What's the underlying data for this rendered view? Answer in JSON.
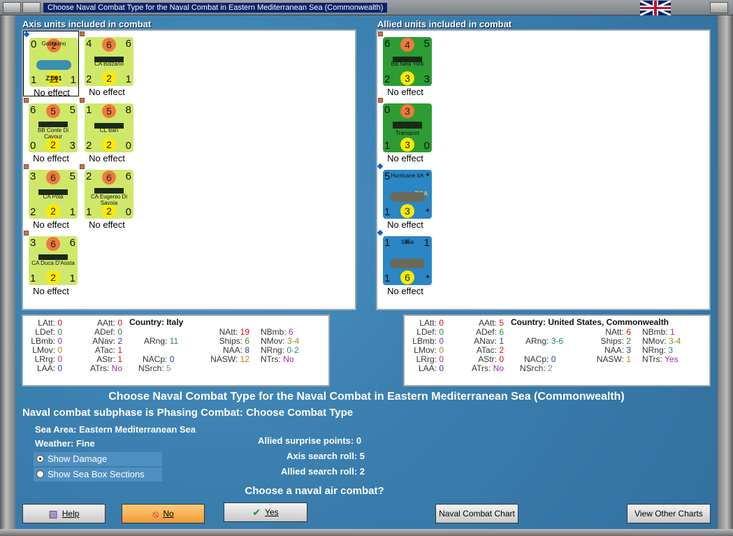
{
  "window": {
    "title": "Choose Naval Combat Type for the Naval Combat in Eastern Mediterranean Sea (Commonwealth)"
  },
  "axis": {
    "title": "Axis units included in combat",
    "units": [
      {
        "name": "Gabbiano",
        "sub": "Z.501",
        "tl": "0",
        "tm": "2",
        "tr": "",
        "bl": "1",
        "bm": "11",
        "br": "1",
        "effect": "No effect",
        "color": "yellow",
        "kind": "plane"
      },
      {
        "name": "CA Bolzano",
        "sub": "",
        "tl": "4",
        "tm": "6",
        "tr": "6",
        "bl": "2",
        "bm": "2",
        "br": "1",
        "effect": "No effect",
        "color": "yellow",
        "kind": "ship"
      },
      {
        "name": "BB Conte Di Cavour",
        "sub": "",
        "tl": "6",
        "tm": "5",
        "tr": "5",
        "bl": "0",
        "bm": "2",
        "br": "3",
        "effect": "No effect",
        "color": "yellow",
        "kind": "ship"
      },
      {
        "name": "CL Bari",
        "sub": "",
        "tl": "1",
        "tm": "5",
        "tr": "8",
        "bl": "2",
        "bm": "2",
        "br": "0",
        "effect": "No effect",
        "color": "yellow",
        "kind": "ship"
      },
      {
        "name": "CA Pola",
        "sub": "",
        "tl": "3",
        "tm": "6",
        "tr": "5",
        "bl": "2",
        "bm": "2",
        "br": "1",
        "effect": "No effect",
        "color": "yellow",
        "kind": "ship"
      },
      {
        "name": "CA Eugenio Di Savoia",
        "sub": "",
        "tl": "2",
        "tm": "6",
        "tr": "6",
        "bl": "1",
        "bm": "2",
        "br": "0",
        "effect": "No effect",
        "color": "yellow",
        "kind": "ship"
      },
      {
        "name": "CA Duca D'Aosta",
        "sub": "",
        "tl": "3",
        "tm": "6",
        "tr": "6",
        "bl": "1",
        "bm": "2",
        "br": "1",
        "effect": "No effect",
        "color": "yellow",
        "kind": "ship"
      }
    ]
  },
  "allied": {
    "title": "Allied units included in combat",
    "units": [
      {
        "name": "BB New York",
        "sub": "",
        "tl": "6",
        "tm": "4",
        "tr": "5",
        "bl": "2",
        "bm": "3",
        "br": "3",
        "effect": "No effect",
        "color": "green",
        "kind": "ship"
      },
      {
        "name": "Transport",
        "sub": "",
        "tl": "0",
        "tm": "3",
        "tr": "",
        "bl": "1",
        "bm": "3",
        "br": "0",
        "effect": "No effect",
        "color": "green",
        "kind": "transport"
      },
      {
        "name": "Hurricane IIA",
        "sub": "RSA",
        "tl": "5",
        "tm": "",
        "tr": "*",
        "bl": "1",
        "bm": "3",
        "br": "*",
        "effect": "No effect",
        "color": "blue",
        "kind": "plane"
      },
      {
        "name": "Skua",
        "sub": "II",
        "tl": "1",
        "tm": "",
        "tr": "1",
        "bl": "1",
        "bm": "6",
        "br": "*",
        "effect": "No effect",
        "color": "blue",
        "kind": "plane"
      }
    ]
  },
  "axis_stats": {
    "country_label": "Country: Italy",
    "LAtt": "0",
    "LDef": "0",
    "LBmb": "0",
    "LMov": "0",
    "LRrg": "0",
    "LAA": "0",
    "AAtt": "0",
    "ADef": "0",
    "ANav": "2",
    "ATac": "1",
    "AStr": "1",
    "ATrs": "No",
    "ARng": "11",
    "NACp": "0",
    "NSrch": "5",
    "NAtt": "19",
    "Ships": "6",
    "NAA": "8",
    "NASW": "12",
    "NBmb": "6",
    "NMov": "3-4",
    "NRng": "0-2",
    "NTrs": "No"
  },
  "allied_stats": {
    "country_label": "Country: United States, Commonwealth",
    "LAtt": "0",
    "LDef": "0",
    "LBmb": "0",
    "LMov": "0",
    "LRrg": "0",
    "LAA": "0",
    "AAtt": "5",
    "ADef": "6",
    "ANav": "1",
    "ATac": "2",
    "AStr": "0",
    "ATrs": "No",
    "ARng": "3-6",
    "NACp": "0",
    "NSrch": "2",
    "NAtt": "6",
    "Ships": "2",
    "NAA": "3",
    "NASW": "1",
    "NBmb": "1",
    "NMov": "3-4",
    "NRng": "3",
    "NTrs": "Yes"
  },
  "labels": {
    "heading": "Choose Naval Combat Type for the Naval Combat in Eastern Mediterranean Sea (Commonwealth)",
    "subphase": "Naval combat subphase is Phasing Combat: Choose Combat Type",
    "sea_area": "Sea Area:  Eastern Mediterranean Sea",
    "weather": "Weather:  Fine",
    "show_damage": "Show Damage",
    "show_sea_box": "Show Sea Box Sections",
    "surprise": "Allied surprise points:  0",
    "axis_search": "Axis search roll:  5",
    "allied_search": "Allied search roll:  2",
    "question": "Choose a naval air combat?"
  },
  "buttons": {
    "help": "Help",
    "no": "No",
    "yes": "Yes",
    "naval_chart": "Naval Combat Chart",
    "other_charts": "View Other Charts"
  }
}
